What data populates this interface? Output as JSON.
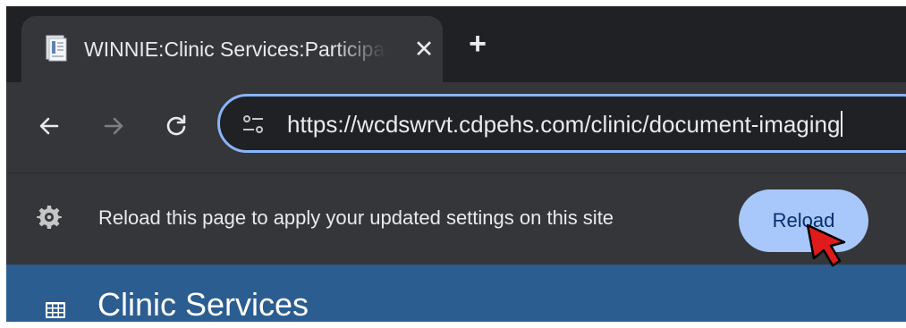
{
  "tab": {
    "title": "WINNIE:Clinic Services:Participant Search",
    "close_symbol": "✕",
    "favicon": "document-favicon"
  },
  "new_tab_symbol": "+",
  "toolbar": {
    "back_icon": "back-arrow-icon",
    "forward_icon": "forward-arrow-icon",
    "reload_icon": "reload-icon"
  },
  "omnibox": {
    "url": "https://wcdswrvt.cdpehs.com/clinic/document-imaging",
    "site_info_icon": "tune-icon"
  },
  "infobar": {
    "message": "Reload this page to apply your updated settings on this site",
    "reload_label": "Reload",
    "icon": "gear-icon"
  },
  "page": {
    "title": "Clinic Services",
    "icon": "grid-icon"
  },
  "colors": {
    "accent": "#8ab4f8",
    "button": "#a8c7fa",
    "header": "#2b5d91"
  }
}
